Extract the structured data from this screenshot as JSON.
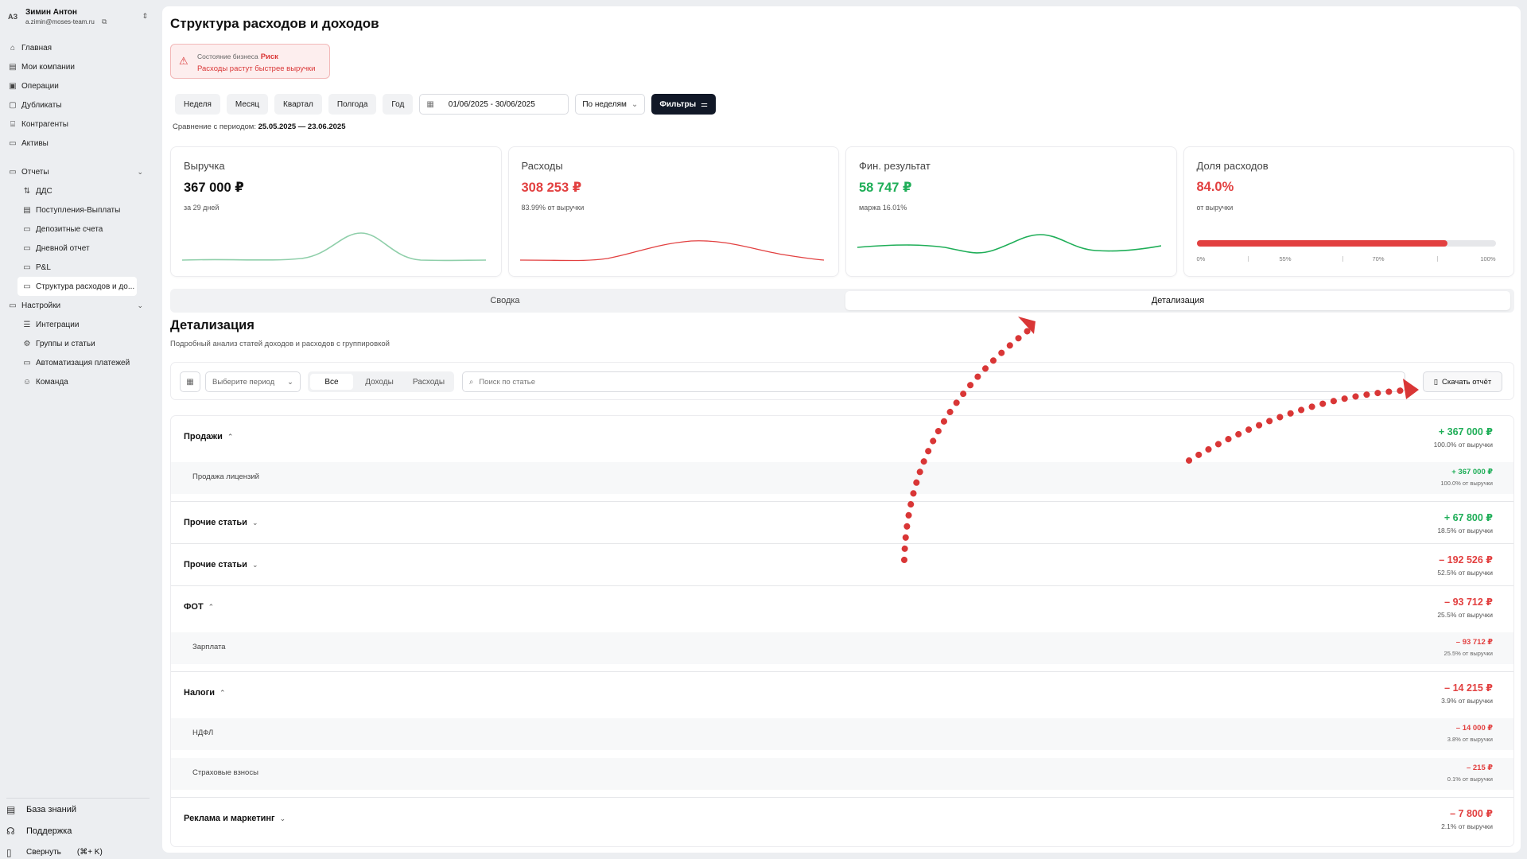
{
  "user": {
    "initials": "АЗ",
    "name": "Зимин Антон",
    "email": "a.zimin@moses-team.ru"
  },
  "sidebar": {
    "top": [
      {
        "label": "Главная",
        "icon": "home-icon",
        "glyph": "⌂"
      },
      {
        "label": "Мои компании",
        "icon": "building-icon",
        "glyph": "▤"
      },
      {
        "label": "Операции",
        "icon": "operations-icon",
        "glyph": "▣"
      },
      {
        "label": "Дубликаты",
        "icon": "duplicates-icon",
        "glyph": "▢"
      },
      {
        "label": "Контрагенты",
        "icon": "bank-icon",
        "glyph": "⌸"
      },
      {
        "label": "Активы",
        "icon": "assets-icon",
        "glyph": "▭"
      }
    ],
    "reports": {
      "label": "Отчеты",
      "items": [
        {
          "label": "ДДС",
          "glyph": "⇅"
        },
        {
          "label": "Поступления-Выплаты",
          "glyph": "▤"
        },
        {
          "label": "Депозитные счета",
          "glyph": "▭"
        },
        {
          "label": "Дневной отчет",
          "glyph": "▭"
        },
        {
          "label": "P&L",
          "glyph": "▭"
        },
        {
          "label": "Структура расходов и до...",
          "glyph": "▭"
        }
      ]
    },
    "settings": {
      "label": "Настройки",
      "items": [
        {
          "label": "Интеграции",
          "glyph": "☰"
        },
        {
          "label": "Группы и статьи",
          "glyph": "⚙"
        },
        {
          "label": "Автоматизация платежей",
          "glyph": "▭"
        },
        {
          "label": "Команда",
          "glyph": "☺"
        }
      ]
    },
    "bottom": {
      "knowledge": "База знаний",
      "support": "Поддержка",
      "collapse": "Свернуть",
      "shortcut": "(⌘+ K)"
    }
  },
  "page": {
    "title": "Структура расходов и доходов",
    "alert": {
      "label": "Состояние бизнеса",
      "status": "Риск",
      "message": "Расходы растут быстрее выручки"
    },
    "periods": [
      "Неделя",
      "Месяц",
      "Квартал",
      "Полгода",
      "Год"
    ],
    "date_range": "01/06/2025 - 30/06/2025",
    "grouping": "По неделям",
    "filters": "Фильтры",
    "compare_label": "Сравнение с периодом:",
    "compare_value": "25.05.2025 — 23.06.2025"
  },
  "kpis": {
    "revenue": {
      "title": "Выручка",
      "value": "367 000 ₽",
      "sub": "за 29 дней"
    },
    "expenses": {
      "title": "Расходы",
      "value": "308 253 ₽",
      "sub": "83.99% от выручки"
    },
    "result": {
      "title": "Фин. результат",
      "value": "58 747 ₽",
      "sub": "маржа 16.01%"
    },
    "share": {
      "title": "Доля расходов",
      "value": "84.0%",
      "sub": "от выручки",
      "fill_percent": 84,
      "ticks": [
        "0%",
        "55%",
        "70%",
        "100%"
      ]
    }
  },
  "colors": {
    "red": "#e24040",
    "green": "#1fae58",
    "teal": "#8fcfaa",
    "dark": "#111827"
  },
  "tabs": [
    "Сводка",
    "Детализация"
  ],
  "detail": {
    "title": "Детализация",
    "subtitle": "Подробный анализ статей доходов и расходов с группировкой",
    "period_placeholder": "Выберите период",
    "segments": [
      "Все",
      "Доходы",
      "Расходы"
    ],
    "search_placeholder": "Поиск по статье",
    "download": "Скачать отчёт"
  },
  "rows": {
    "sales": {
      "name": "Продажи",
      "value": "+ 367 000 ₽",
      "pct": "100.0% от выручки",
      "sub": {
        "name": "Продажа лицензий",
        "value": "+ 367 000 ₽",
        "pct": "100.0% от выручки"
      }
    },
    "other_in": {
      "name": "Прочие статьи",
      "value": "+ 67 800 ₽",
      "pct": "18.5% от выручки"
    },
    "other_out": {
      "name": "Прочие статьи",
      "value": "– 192 526 ₽",
      "pct": "52.5% от выручки"
    },
    "fot": {
      "name": "ФОТ",
      "value": "– 93 712 ₽",
      "pct": "25.5% от выручки",
      "sub": {
        "name": "Зарплата",
        "value": "– 93 712 ₽",
        "pct": "25.5% от выручки"
      }
    },
    "taxes": {
      "name": "Налоги",
      "value": "– 14 215 ₽",
      "pct": "3.9% от выручки",
      "sub1": {
        "name": "НДФЛ",
        "value": "– 14 000 ₽",
        "pct": "3.8% от выручки"
      },
      "sub2": {
        "name": "Страховые взносы",
        "value": "– 215 ₽",
        "pct": "0.1% от выручки"
      }
    },
    "marketing": {
      "name": "Реклама и маркетинг",
      "value": "– 7 800 ₽",
      "pct": "2.1% от выручки"
    }
  }
}
